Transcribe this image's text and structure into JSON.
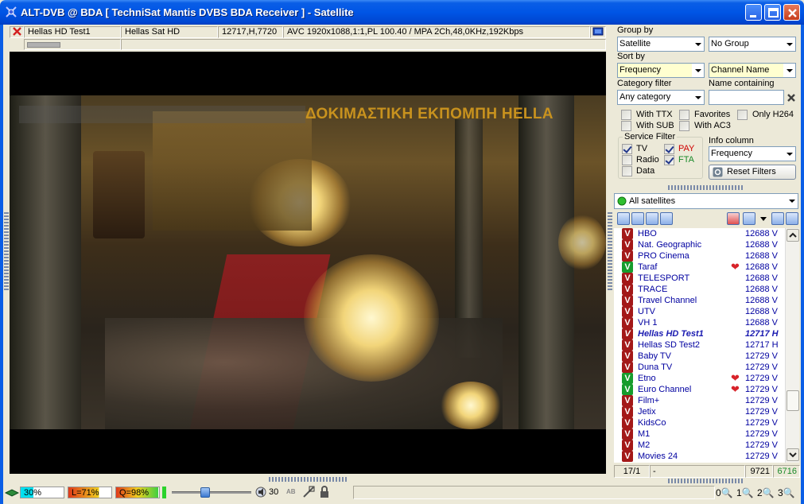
{
  "window": {
    "title": "ALT-DVB @ BDA [ TechniSat Mantis DVBS BDA Receiver ] - Satellite"
  },
  "infobar": {
    "channel": "Hellas HD Test1",
    "provider": "Hellas Sat HD",
    "transponder": "12717,H,7720",
    "stream": "AVC 1920x1088,1:1,PL 100.40 / MPA 2Ch,48,0KHz,192Kbps"
  },
  "video": {
    "ticker_text": "ΔΟΚΙΜΑΣΤΙΚΗ ΕΚΠΟΜΠΗ HELLA"
  },
  "panel": {
    "group_by_label": "Group by",
    "group_by_value": "Satellite",
    "group_by_second": "No Group",
    "sort_by_label": "Sort by",
    "sort_by_value": "Frequency",
    "sort_by_second": "Channel Name",
    "category_label": "Category filter",
    "category_value": "Any category",
    "name_label": "Name containing",
    "name_value": "",
    "checks": {
      "with_ttx": "With TTX",
      "favorites": "Favorites",
      "only_h264": "Only H264",
      "with_sub": "With SUB",
      "with_ac3": "With AC3"
    },
    "service_filter": {
      "title": "Service Filter",
      "tv": "TV",
      "radio": "Radio",
      "data": "Data",
      "pay": "PAY",
      "fta": "FTA"
    },
    "info_column_label": "Info column",
    "info_column_value": "Frequency",
    "reset_button": "Reset Filters",
    "satellite_select": "All satellites"
  },
  "channels": [
    {
      "name": "HBO",
      "freq": "12688 V",
      "badge": "V",
      "type": "red",
      "fav": false,
      "current": false
    },
    {
      "name": "Nat. Geographic",
      "freq": "12688 V",
      "badge": "V",
      "type": "red",
      "fav": false,
      "current": false
    },
    {
      "name": "PRO Cinema",
      "freq": "12688 V",
      "badge": "V",
      "type": "red",
      "fav": false,
      "current": false
    },
    {
      "name": "Taraf",
      "freq": "12688 V",
      "badge": "V",
      "type": "green",
      "fav": true,
      "current": false
    },
    {
      "name": "TELESPORT",
      "freq": "12688 V",
      "badge": "V",
      "type": "red",
      "fav": false,
      "current": false
    },
    {
      "name": "TRACE",
      "freq": "12688 V",
      "badge": "V",
      "type": "red",
      "fav": false,
      "current": false
    },
    {
      "name": "Travel Channel",
      "freq": "12688 V",
      "badge": "V",
      "type": "red",
      "fav": false,
      "current": false
    },
    {
      "name": "UTV",
      "freq": "12688 V",
      "badge": "V",
      "type": "red",
      "fav": false,
      "current": false
    },
    {
      "name": "VH 1",
      "freq": "12688 V",
      "badge": "V",
      "type": "red",
      "fav": false,
      "current": false
    },
    {
      "name": "Hellas HD Test1",
      "freq": "12717 H",
      "badge": "V",
      "type": "red",
      "fav": false,
      "current": true
    },
    {
      "name": "Hellas SD Test2",
      "freq": "12717 H",
      "badge": "V",
      "type": "red",
      "fav": false,
      "current": false
    },
    {
      "name": "Baby TV",
      "freq": "12729 V",
      "badge": "V",
      "type": "red",
      "fav": false,
      "current": false
    },
    {
      "name": "Duna TV",
      "freq": "12729 V",
      "badge": "V",
      "type": "red",
      "fav": false,
      "current": false
    },
    {
      "name": "Etno",
      "freq": "12729 V",
      "badge": "V",
      "type": "green",
      "fav": true,
      "current": false
    },
    {
      "name": "Euro Channel",
      "freq": "12729 V",
      "badge": "V",
      "type": "green",
      "fav": true,
      "current": false
    },
    {
      "name": "Film+",
      "freq": "12729 V",
      "badge": "V",
      "type": "red",
      "fav": false,
      "current": false
    },
    {
      "name": "Jetix",
      "freq": "12729 V",
      "badge": "V",
      "type": "red",
      "fav": false,
      "current": false
    },
    {
      "name": "KidsCo",
      "freq": "12729 V",
      "badge": "V",
      "type": "red",
      "fav": false,
      "current": false
    },
    {
      "name": "M1",
      "freq": "12729 V",
      "badge": "V",
      "type": "red",
      "fav": false,
      "current": false
    },
    {
      "name": "M2",
      "freq": "12729 V",
      "badge": "V",
      "type": "red",
      "fav": false,
      "current": false
    },
    {
      "name": "Movies 24",
      "freq": "12729 V",
      "badge": "V",
      "type": "red",
      "fav": false,
      "current": false
    }
  ],
  "list_status": {
    "position": "17/1",
    "filter": "-",
    "total": "9721",
    "count": "6716"
  },
  "statusbar": {
    "signal": "30%",
    "level": "L=71%",
    "quality": "Q=98%",
    "volume": "30",
    "volume_level": 0.3,
    "zoom": [
      "0",
      "1",
      "2",
      "3"
    ]
  },
  "colors": {
    "signal_fill": "#00e0f0",
    "level_fill": "#e03a1a",
    "quality_fill": "#e03a1a",
    "ticker": "#c8921e"
  }
}
